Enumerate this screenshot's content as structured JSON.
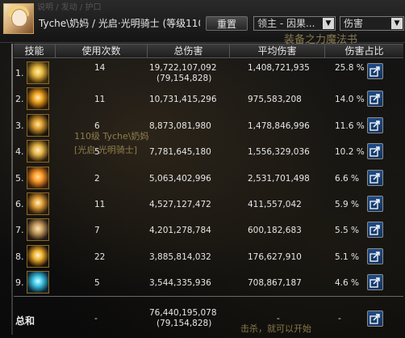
{
  "header": {
    "tab_strip": "说明 / 发动 / 护口",
    "title": "Tyche\\奶妈 / 光启·光明骑士 (等级110",
    "reset_label": "重置",
    "mode_select": "领主 - 因果...",
    "metric_select": "伤害"
  },
  "background_texts": [
    "装备之力魔法书",
    "110级 Tyche\\奶妈",
    "[光启·光明骑士]",
    "击杀，就可以开始"
  ],
  "columns": [
    "技能",
    "使用次数",
    "总伤害",
    "平均伤害",
    "伤害占比"
  ],
  "rows": [
    {
      "index": "1.",
      "count": "14",
      "total": "19,722,107,092",
      "total_sub": "(79,154,828)",
      "avg": "1,408,721,935",
      "pct": "25.8 %",
      "icon": "skill-icon-1"
    },
    {
      "index": "2.",
      "count": "11",
      "total": "10,731,415,296",
      "total_sub": "",
      "avg": "975,583,208",
      "pct": "14.0 %",
      "icon": "skill-icon-2"
    },
    {
      "index": "3.",
      "count": "6",
      "total": "8,873,081,980",
      "total_sub": "",
      "avg": "1,478,846,996",
      "pct": "11.6 %",
      "icon": "skill-icon-3"
    },
    {
      "index": "4.",
      "count": "5",
      "total": "7,781,645,180",
      "total_sub": "",
      "avg": "1,556,329,036",
      "pct": "10.2 %",
      "icon": "skill-icon-4"
    },
    {
      "index": "5.",
      "count": "2",
      "total": "5,063,402,996",
      "total_sub": "",
      "avg": "2,531,701,498",
      "pct": "6.6 %",
      "icon": "skill-icon-5"
    },
    {
      "index": "6.",
      "count": "11",
      "total": "4,527,127,472",
      "total_sub": "",
      "avg": "411,557,042",
      "pct": "5.9 %",
      "icon": "skill-icon-6"
    },
    {
      "index": "7.",
      "count": "7",
      "total": "4,201,278,784",
      "total_sub": "",
      "avg": "600,182,683",
      "pct": "5.5 %",
      "icon": "skill-icon-7"
    },
    {
      "index": "8.",
      "count": "22",
      "total": "3,885,814,032",
      "total_sub": "",
      "avg": "176,627,910",
      "pct": "5.1 %",
      "icon": "skill-icon-8"
    },
    {
      "index": "9.",
      "count": "5",
      "total": "3,544,335,936",
      "total_sub": "",
      "avg": "708,867,187",
      "pct": "4.6 %",
      "icon": "skill-icon-9"
    }
  ],
  "summary": {
    "label": "总和",
    "count": "-",
    "total": "76,440,195,078",
    "total_sub": "(79,154,828)",
    "avg": "-",
    "pct": "-"
  },
  "colors": {
    "text": "#e6e6e6",
    "share_button": "#1f4c86",
    "icon_border": "#8a6a2a"
  }
}
